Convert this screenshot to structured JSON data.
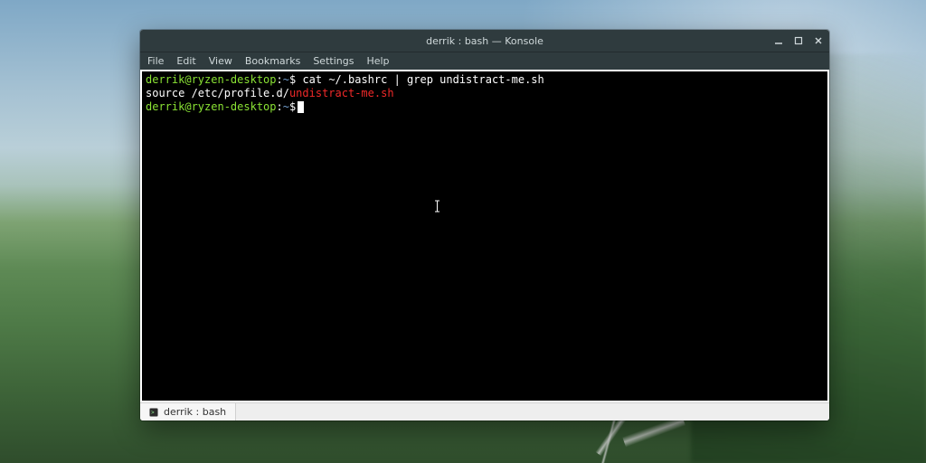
{
  "window": {
    "title": "derrik : bash — Konsole",
    "controls": {
      "minimize": "minimize",
      "maximize": "maximize",
      "close": "close"
    }
  },
  "menubar": {
    "items": [
      "File",
      "Edit",
      "View",
      "Bookmarks",
      "Settings",
      "Help"
    ]
  },
  "terminal": {
    "lines": [
      {
        "type": "prompt",
        "userhost": "derrik@ryzen-desktop",
        "sep1": ":",
        "path": "~",
        "sep2": "$",
        "command": "cat ~/.bashrc | grep undistract-me.sh"
      },
      {
        "type": "output",
        "plain": "source /etc/profile.d/",
        "match": "undistract-me.sh"
      },
      {
        "type": "prompt",
        "userhost": "derrik@ryzen-desktop",
        "sep1": ":",
        "path": "~",
        "sep2": "$",
        "command": "",
        "cursor": true
      }
    ]
  },
  "tabbar": {
    "tabs": [
      {
        "label": "derrik : bash",
        "icon": "terminal-icon"
      }
    ]
  },
  "colors": {
    "titlebar_bg": "#2f3b3e",
    "terminal_bg": "#000000",
    "prompt_user": "#8ae234",
    "prompt_path": "#729fcf",
    "grep_match": "#ef2929"
  }
}
